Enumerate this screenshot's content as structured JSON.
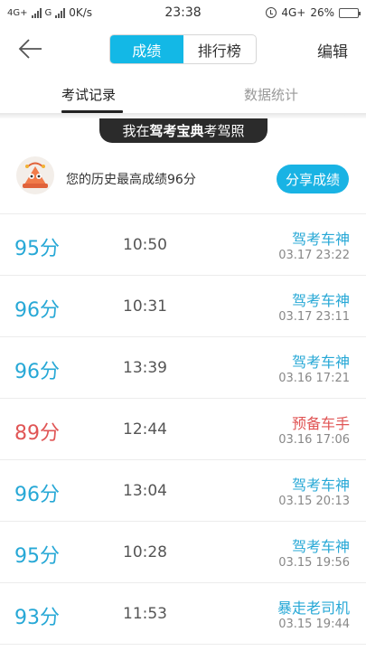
{
  "status_bar": {
    "left_net1": "4G+",
    "left_net2": "G",
    "speed": "0K/s",
    "time": "23:38",
    "right_net": "4G+",
    "battery": "26%"
  },
  "header": {
    "tabs": [
      "成绩",
      "排行榜"
    ],
    "active_tab": "成绩",
    "edit_label": "编辑"
  },
  "sub_tabs": {
    "records": "考试记录",
    "stats": "数据统计"
  },
  "banner": {
    "prefix": "我在",
    "brand": "驾考宝典",
    "suffix": "考驾照"
  },
  "best": {
    "text": "您的历史最高成绩96分",
    "share_label": "分享成绩"
  },
  "colors": {
    "accent": "#13b8e6",
    "score_blue": "#27a8d6",
    "score_red": "#e05555"
  },
  "records": [
    {
      "score": "95分",
      "duration": "10:50",
      "title": "驾考车神",
      "date": "03.17  23:22",
      "level": "good"
    },
    {
      "score": "96分",
      "duration": "10:31",
      "title": "驾考车神",
      "date": "03.17  23:11",
      "level": "good"
    },
    {
      "score": "96分",
      "duration": "13:39",
      "title": "驾考车神",
      "date": "03.16  17:21",
      "level": "good"
    },
    {
      "score": "89分",
      "duration": "12:44",
      "title": "预备车手",
      "date": "03.16  17:06",
      "level": "bad"
    },
    {
      "score": "96分",
      "duration": "13:04",
      "title": "驾考车神",
      "date": "03.15  20:13",
      "level": "good"
    },
    {
      "score": "95分",
      "duration": "10:28",
      "title": "驾考车神",
      "date": "03.15  19:56",
      "level": "good"
    },
    {
      "score": "93分",
      "duration": "11:53",
      "title": "暴走老司机",
      "date": "03.15  19:44",
      "level": "good"
    }
  ]
}
